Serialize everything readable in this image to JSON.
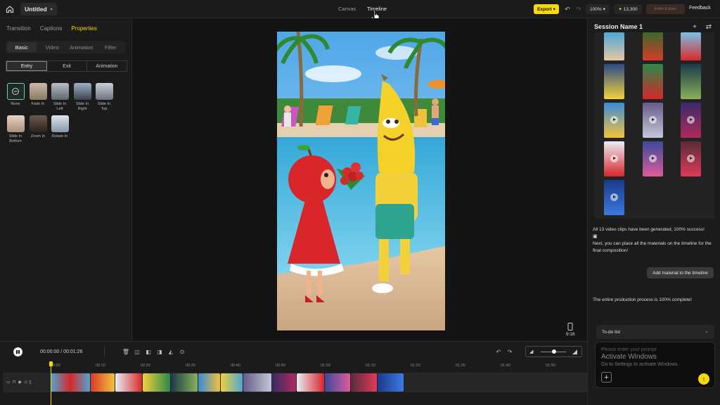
{
  "topbar": {
    "project_title": "Untitled",
    "tabs": [
      {
        "label": "Canvas",
        "active": false
      },
      {
        "label": "Timeline",
        "active": true
      }
    ],
    "export_label": "Export",
    "zoom_label": "100%",
    "credits": "13,300",
    "invite_label": "Invite & Earn",
    "feedback_label": "Feedback"
  },
  "left_panel": {
    "tabs": [
      {
        "label": "Transition"
      },
      {
        "label": "Captions"
      },
      {
        "label": "Properties",
        "active": true
      }
    ],
    "subtabs": [
      {
        "label": "Basic",
        "active": true
      },
      {
        "label": "Video"
      },
      {
        "label": "Animation"
      },
      {
        "label": "Filter"
      }
    ],
    "segments": [
      {
        "label": "Entry",
        "active": true
      },
      {
        "label": "Exit"
      },
      {
        "label": "Animation"
      }
    ],
    "animations": [
      {
        "label": "None"
      },
      {
        "label": "Fade In"
      },
      {
        "label": "Slide In Left"
      },
      {
        "label": "Slide In Right"
      },
      {
        "label": "Slide In Top"
      },
      {
        "label": "Slide In Bottom"
      },
      {
        "label": "Zoom In"
      },
      {
        "label": "Rotate In"
      }
    ]
  },
  "stage": {
    "aspect_ratio": "9:16"
  },
  "right_panel": {
    "session_title": "Session Name 1",
    "message_1": "All 13 video clips have been generated, 100% success!",
    "message_2": "Next, you can place all the materials on the timeline for the final composition!",
    "add_material_label": "Add material to the timeline",
    "message_3": "The entire production process is 100% complete!",
    "todo_label": "To-do list",
    "prompt_placeholder": "Please enter your prompt",
    "watermark_title": "Activate Windows",
    "watermark_sub": "Go to Settings to activate Windows."
  },
  "timeline": {
    "timecode": "00:00:00 / 00:01:26",
    "ruler": [
      "00:00",
      "00:10",
      "00:20",
      "00:30",
      "00:40",
      "00:50",
      "01:00",
      "01:10",
      "01:20",
      "01:30",
      "01:40",
      "01:50"
    ]
  },
  "colors": {
    "accent": "#f5d90a",
    "panel": "#1b1b1b",
    "background": "#141414"
  }
}
